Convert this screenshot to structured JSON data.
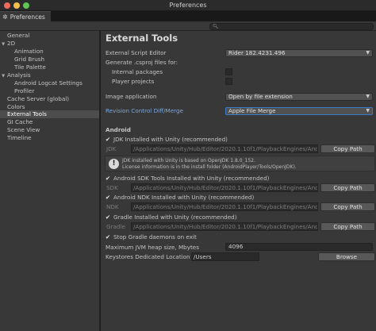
{
  "window": {
    "title": "Preferences"
  },
  "tab": {
    "label": "Preferences",
    "icon": "gear-icon"
  },
  "search": {
    "placeholder": ""
  },
  "sidebar": {
    "items": [
      {
        "label": "General",
        "level": 0
      },
      {
        "label": "2D",
        "level": 0,
        "expanded": true
      },
      {
        "label": "Animation",
        "level": 1
      },
      {
        "label": "Grid Brush",
        "level": 1
      },
      {
        "label": "Tile Palette",
        "level": 1
      },
      {
        "label": "Analysis",
        "level": 0,
        "expanded": true
      },
      {
        "label": "Android Logcat Settings",
        "level": 1
      },
      {
        "label": "Profiler",
        "level": 1
      },
      {
        "label": "Cache Server (global)",
        "level": 0
      },
      {
        "label": "Colors",
        "level": 0
      },
      {
        "label": "External Tools",
        "level": 0,
        "selected": true
      },
      {
        "label": "GI Cache",
        "level": 0
      },
      {
        "label": "Scene View",
        "level": 0
      },
      {
        "label": "Timeline",
        "level": 0
      }
    ]
  },
  "main": {
    "title": "External Tools",
    "script_editor": {
      "label": "External Script Editor",
      "value": "Rider 182.4231.496"
    },
    "generate_label": "Generate .csproj files for:",
    "internal_packages": {
      "label": "Internal packages",
      "checked": false
    },
    "player_projects": {
      "label": "Player projects",
      "checked": false
    },
    "image_application": {
      "label": "Image application",
      "value": "Open by file extension"
    },
    "revision_control": {
      "label": "Revision Control Diff/Merge",
      "value": "Apple File Merge"
    },
    "android": {
      "section_label": "Android",
      "jdk_checkbox": {
        "label": "JDK Installed with Unity (recommended)",
        "checked": true
      },
      "jdk_path": {
        "label": "JDK",
        "value": "/Applications/Unity/Hub/Editor/2020.1.10f1/PlaybackEngines/Androi",
        "button": "Copy Path"
      },
      "jdk_info": {
        "line1": "JDK installed with Unity is based on OpenJDK 1.8.0_152.",
        "line2": "License information is in the install folder (AndroidPlayer/Tools/OpenJDK)."
      },
      "sdk_checkbox": {
        "label": "Android SDK Tools Installed with Unity (recommended)",
        "checked": true
      },
      "sdk_path": {
        "label": "SDK",
        "value": "/Applications/Unity/Hub/Editor/2020.1.10f1/PlaybackEngines/Androi",
        "button": "Copy Path"
      },
      "ndk_checkbox": {
        "label": "Android NDK Installed with Unity (recommended)",
        "checked": true
      },
      "ndk_path": {
        "label": "NDK",
        "value": "/Applications/Unity/Hub/Editor/2020.1.10f1/PlaybackEngines/Androi",
        "button": "Copy Path"
      },
      "gradle_checkbox": {
        "label": "Gradle Installed with Unity (recommended)",
        "checked": true
      },
      "gradle_path": {
        "label": "Gradle",
        "value": "/Applications/Unity/Hub/Editor/2020.1.10f1/PlaybackEngines/Androi",
        "button": "Copy Path"
      },
      "stop_gradle": {
        "label": "Stop Gradle daemons on exit",
        "checked": true
      },
      "jvm_heap": {
        "label": "Maximum JVM heap size, Mbytes",
        "value": "4096"
      },
      "keystores": {
        "label": "Keystores Dedicated Location",
        "value": "/Users",
        "button": "Browse"
      }
    }
  },
  "colors": {
    "accent_link": "#7ba7e0",
    "focus_border": "#3b79c9",
    "selection_bg": "#4d4d4d"
  }
}
